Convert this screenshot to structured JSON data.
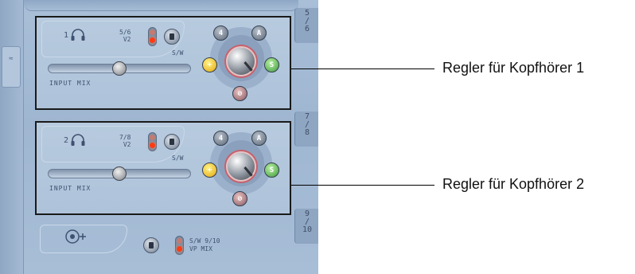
{
  "mixer": {
    "side_tabs": [
      "5\n/\n6",
      "7\n/\n8",
      "9\n/\n10"
    ],
    "left_strip_label": "≈",
    "channels": [
      {
        "number": "1",
        "source_label_line1": "5/6",
        "source_label_line2": "V2",
        "sw_label": "S/W",
        "input_mix_label": "INPUT MIX",
        "input_mix_level": 0.5,
        "buses": {
          "top_left": "4",
          "top_right": "A",
          "left": "+",
          "right": "S",
          "bottom": "⊘"
        }
      },
      {
        "number": "2",
        "source_label_line1": "7/8",
        "source_label_line2": "V2",
        "sw_label": "S/W",
        "input_mix_label": "INPUT MIX",
        "input_mix_level": 0.5,
        "buses": {
          "top_left": "4",
          "top_right": "A",
          "left": "+",
          "right": "S",
          "bottom": "⊘"
        }
      }
    ],
    "bottom_section": {
      "label_line1": "S/W 9/10",
      "label_line2": "VP MIX"
    }
  },
  "callouts": [
    {
      "text": "Regler für Kopfhörer 1"
    },
    {
      "text": "Regler für Kopfhörer 2"
    }
  ],
  "colors": {
    "panel_blue": "#a9bfd8",
    "led_active": "#ff3b12",
    "bus_yellow": "#e3a70c",
    "bus_green": "#3e9a3c",
    "callout_border": "#1a1a1a"
  },
  "icons": {
    "channel": "headphones-icon",
    "bottom": "output-plug-icon",
    "main_knob": "volume-knob"
  }
}
